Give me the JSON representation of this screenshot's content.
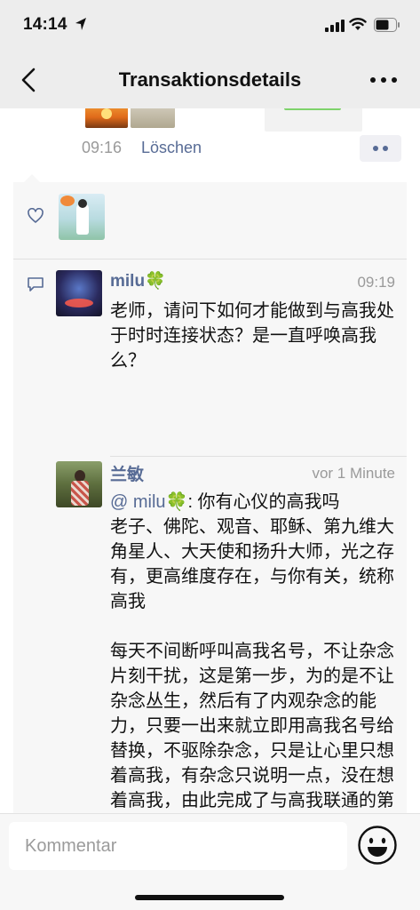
{
  "status_bar": {
    "time": "14:14"
  },
  "nav": {
    "title": "Transaktionsdetails"
  },
  "post": {
    "time": "09:16",
    "delete_label": "Löschen"
  },
  "comments": [
    {
      "name": "milu",
      "emoji": "🍀",
      "time": "09:19",
      "text": "老师，请问下如何才能做到与高我处于时时连接状态？是一直呼唤高我么？"
    },
    {
      "name": "兰敏",
      "time": "vor 1 Minute",
      "mention": "@ milu🍀",
      "text": ": 你有心仪的高我吗\n老子、佛陀、观音、耶稣、第九维大角星人、大天使和扬升大师，光之存有，更高维度存在，与你有关，统称高我\n\n每天不间断呼叫高我名号，不让杂念片刻干扰，这是第一步，为的是不让杂念丛生，然后有了内观杂念的能力，只要一出来就立即用高我名号给替换，不驱除杂念，只是让心里只想着高我，有杂念只说明一点，没在想着高我，由此完成了与高我联通的第一步：时刻想着，成为每天即使在沉思时都不忘其在左右的程度"
    }
  ],
  "input": {
    "placeholder": "Kommentar"
  },
  "colors": {
    "link": "#576b95",
    "background": "#ededed",
    "panel": "#f7f7f7"
  }
}
